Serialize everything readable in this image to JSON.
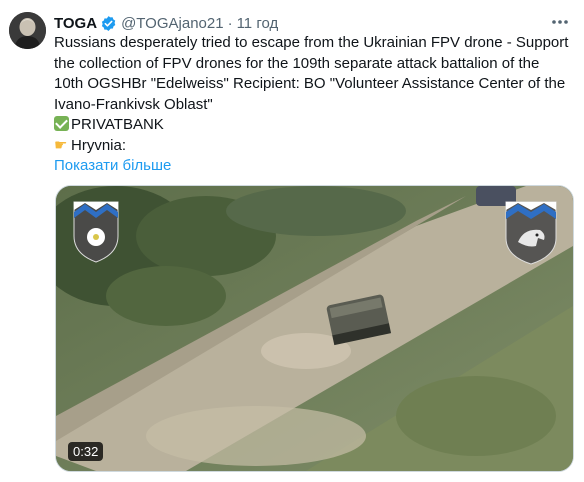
{
  "author": {
    "name": "TOGA",
    "handle": "@TOGAjano21",
    "time": "11 год"
  },
  "tweet": {
    "lines": [
      "Russians desperately tried to escape from the Ukrainian FPV drone - Support",
      "the collection of FPV drones for the 109th separate attack battalion of the",
      "10th OGSHBr \"Edelweiss\" Recipient: BO \"Volunteer Assistance Center of the",
      "Ivano-Frankivsk Oblast\""
    ],
    "bank_label": "PRIVATBANK",
    "currency_label": "Hryvnia:",
    "show_more": "Показати більше"
  },
  "media": {
    "duration": "0:32"
  },
  "icons": {
    "verified": "verified-badge-icon",
    "more": "more-options-icon",
    "check": "check-mark-emoji",
    "pointing_hand": "pointing-hand-emoji"
  },
  "colors": {
    "accent": "#1d9bf0",
    "secondary_text": "#536471"
  }
}
